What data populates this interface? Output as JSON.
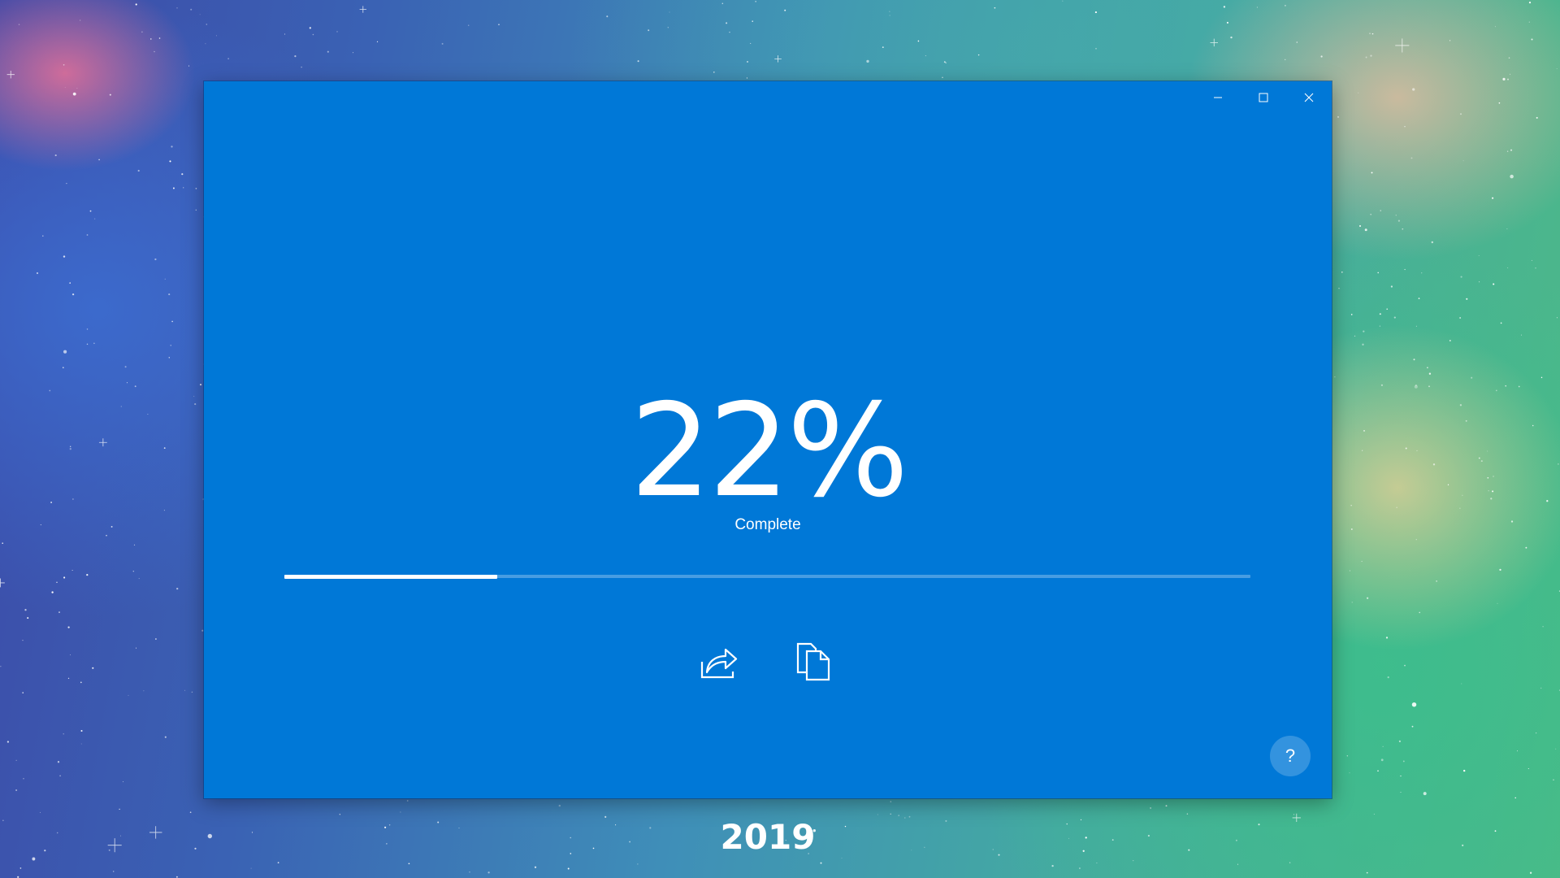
{
  "window": {
    "caption_buttons": [
      {
        "name": "minimize",
        "icon": "minimize-icon"
      },
      {
        "name": "maximize",
        "icon": "maximize-icon"
      },
      {
        "name": "close",
        "icon": "close-icon"
      }
    ]
  },
  "progress": {
    "percent_text": "22%",
    "status_label": "Complete",
    "value_fraction": 0.22
  },
  "actions": [
    {
      "name": "share",
      "icon": "share-icon"
    },
    {
      "name": "copy",
      "icon": "copy-icon"
    }
  ],
  "footer": {
    "year": "2019",
    "help_label": "?"
  },
  "colors": {
    "accent": "#0078d7",
    "foreground": "#ffffff",
    "progress_track": "rgba(255,255,255,0.28)"
  }
}
